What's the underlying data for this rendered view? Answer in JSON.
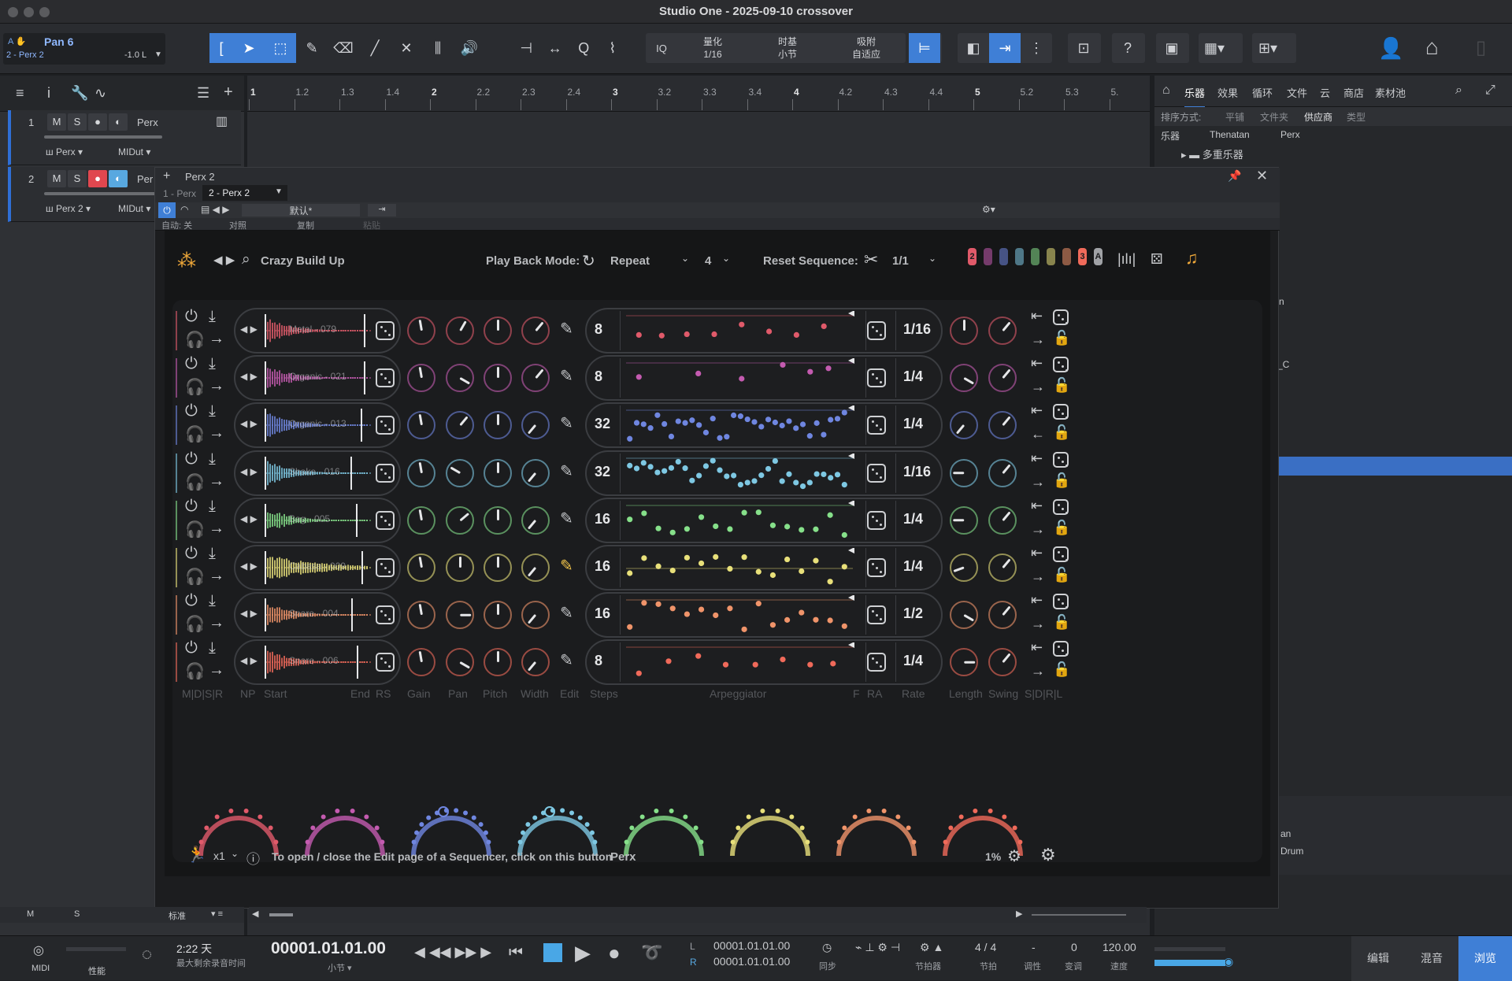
{
  "window": {
    "title": "Studio One - 2025-09-10 crossover"
  },
  "selector": {
    "name": "Pan 6",
    "track": "2 - Perx 2",
    "value": "-1.0 L"
  },
  "toolbar": {
    "iq": "IQ",
    "quantize_label": "量化",
    "quantize_value": "1/16",
    "timebase_label": "时基",
    "timebase_value": "小节",
    "snap_label": "吸附",
    "snap_value": "自适应"
  },
  "ruler": {
    "ticks": [
      "1",
      "1.2",
      "1.3",
      "1.4",
      "2",
      "2.2",
      "2.3",
      "2.4",
      "3",
      "3.2",
      "3.3",
      "3.4",
      "4",
      "4.2",
      "4.3",
      "4.4",
      "5",
      "5.2",
      "5.3",
      "5."
    ]
  },
  "tracks": [
    {
      "num": "1",
      "name": "Perx",
      "instrument": "Perx",
      "midi": "MIDut"
    },
    {
      "num": "2",
      "name": "Per",
      "instrument": "Perx 2",
      "midi": "MIDut"
    }
  ],
  "track_btns": {
    "m": "M",
    "s": "S"
  },
  "browser": {
    "tabs": [
      "乐器",
      "效果",
      "循环",
      "文件",
      "云",
      "商店",
      "素材池"
    ],
    "sort_label": "排序方式:",
    "sort_options": [
      "平铺",
      "文件夹",
      "供应商",
      "类型"
    ],
    "path": [
      "乐器",
      "Thenatan",
      "Perx"
    ],
    "folder": "多重乐器",
    "partial1": "n",
    "partial2": "_C",
    "partial3": "an",
    "partial4": "Drum"
  },
  "plugwin": {
    "title": "Perx 2",
    "tab1": "1 - Perx",
    "tab2": "2 - Perx 2",
    "preset": "默认*",
    "auto": "自动: 关",
    "compare": "对照",
    "copy": "复制",
    "paste": "粘贴"
  },
  "plugin": {
    "preset_name": "Crazy Build Up",
    "playback_label": "Play Back Mode:",
    "playback_value": "Repeat",
    "playback_count": "4",
    "reset_label": "Reset Sequence:",
    "reset_value": "1/1",
    "badge_left": "2",
    "badge_mid": "3",
    "badge_a": "A",
    "footer_mult": "x1",
    "footer_hint": "To open / close the Edit page of a Sequencer, click on this button",
    "footer_name": "Perx",
    "footer_pct": "1%",
    "labels": {
      "mdsr": "M|D|S|R",
      "np": "NP",
      "start": "Start",
      "end": "End",
      "rs": "RS",
      "gain": "Gain",
      "pan": "Pan",
      "pitch": "Pitch",
      "width": "Width",
      "edit": "Edit",
      "steps": "Steps",
      "arp": "Arpeggiator",
      "f": "F",
      "ra": "RA",
      "rate": "Rate",
      "length": "Length",
      "swing": "Swing",
      "sdrl": "S|D|R|L"
    },
    "rows": [
      {
        "sample": "Metal - 079",
        "steps": "8",
        "rate": "1/16",
        "color": "#e05a6a"
      },
      {
        "sample": "Organic - 021",
        "steps": "8",
        "rate": "1/4",
        "color": "#c45bb0"
      },
      {
        "sample": "Organic - 013",
        "steps": "32",
        "rate": "1/4",
        "color": "#6f86e0"
      },
      {
        "sample": "Shake - 016",
        "steps": "32",
        "rate": "1/16",
        "color": "#7ec8e3"
      },
      {
        "sample": "Bag - 005",
        "steps": "16",
        "rate": "1/4",
        "color": "#86e08a"
      },
      {
        "sample": "Cabasa - 009",
        "steps": "16",
        "rate": "1/4",
        "color": "#e8e07a"
      },
      {
        "sample": "Snare - 004",
        "steps": "16",
        "rate": "1/2",
        "color": "#f0946a"
      },
      {
        "sample": "Snare - 006",
        "steps": "8",
        "rate": "1/4",
        "color": "#f06a5a"
      }
    ]
  },
  "bottom": {
    "m": "M",
    "s": "S",
    "mode": "标准"
  },
  "transport": {
    "midi": "MIDI",
    "perf": "性能",
    "rec_time": "2:22 天",
    "rec_label": "最大剩余录音时间",
    "position": "00001.01.01.00",
    "position_unit": "小节",
    "l_pos": "00001.01.01.00",
    "r_pos": "00001.01.01.00",
    "sync": "同步",
    "metronome": "节拍器",
    "signature": "4 / 4",
    "sig_label": "节拍",
    "key": "-",
    "key_label": "调性",
    "transpose": "0",
    "transpose_label": "变调",
    "tempo": "120.00",
    "tempo_label": "速度",
    "edit": "编辑",
    "mix": "混音",
    "browse": "浏览"
  }
}
